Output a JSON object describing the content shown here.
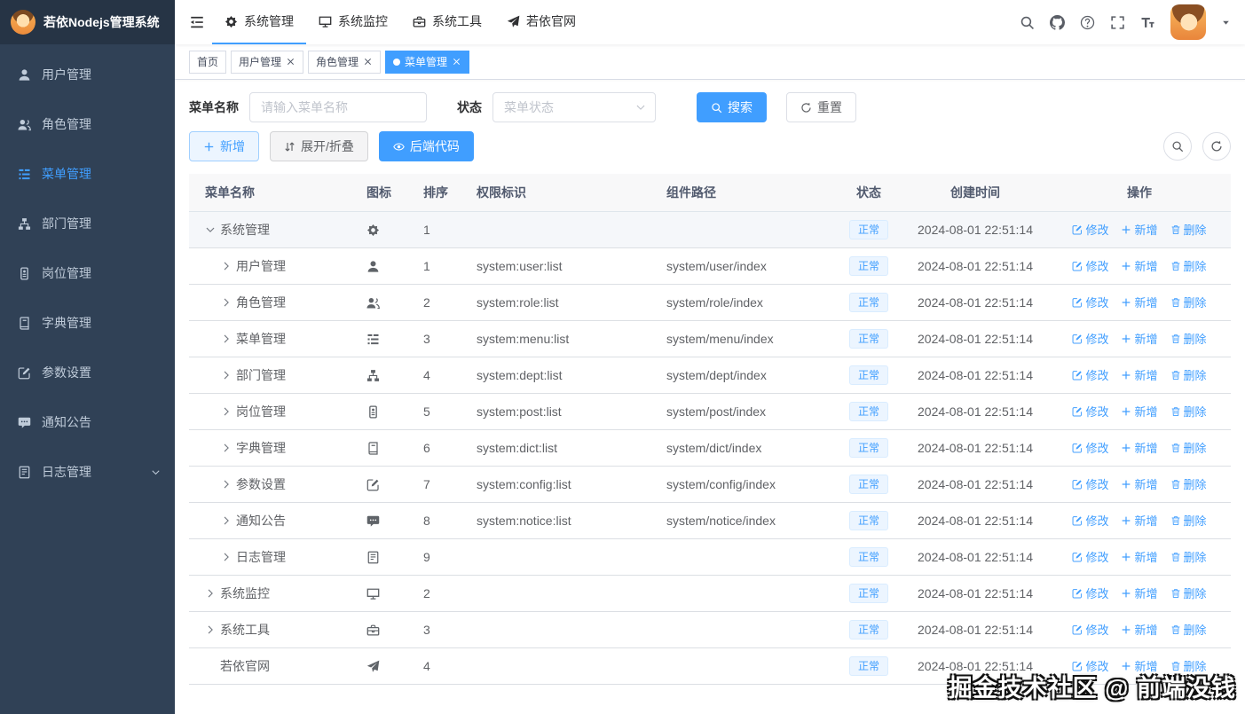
{
  "app": {
    "title": "若依Nodejs管理系统"
  },
  "colors": {
    "primary": "#409eff",
    "sidebar_bg": "#304156",
    "tag_active_bg": "#409eff",
    "status_tag_bg": "#ecf5ff"
  },
  "navbar": {
    "menus": [
      {
        "label": "系统管理",
        "icon": "gear",
        "active": true
      },
      {
        "label": "系统监控",
        "icon": "monitor",
        "active": false
      },
      {
        "label": "系统工具",
        "icon": "tool",
        "active": false
      },
      {
        "label": "若依官网",
        "icon": "guide",
        "active": false
      }
    ]
  },
  "sidebar": {
    "items": [
      {
        "label": "用户管理",
        "icon": "user",
        "active": false,
        "has_children": false
      },
      {
        "label": "角色管理",
        "icon": "peoples",
        "active": false,
        "has_children": false
      },
      {
        "label": "菜单管理",
        "icon": "tree-table",
        "active": true,
        "has_children": false
      },
      {
        "label": "部门管理",
        "icon": "tree",
        "active": false,
        "has_children": false
      },
      {
        "label": "岗位管理",
        "icon": "post",
        "active": false,
        "has_children": false
      },
      {
        "label": "字典管理",
        "icon": "dict",
        "active": false,
        "has_children": false
      },
      {
        "label": "参数设置",
        "icon": "edit",
        "active": false,
        "has_children": false
      },
      {
        "label": "通知公告",
        "icon": "message",
        "active": false,
        "has_children": false
      },
      {
        "label": "日志管理",
        "icon": "log",
        "active": false,
        "has_children": true
      }
    ]
  },
  "tabs": [
    {
      "label": "首页",
      "closable": false,
      "active": false
    },
    {
      "label": "用户管理",
      "closable": true,
      "active": false
    },
    {
      "label": "角色管理",
      "closable": true,
      "active": false
    },
    {
      "label": "菜单管理",
      "closable": true,
      "active": true
    }
  ],
  "filters": {
    "name_label": "菜单名称",
    "name_placeholder": "请输入菜单名称",
    "status_label": "状态",
    "status_placeholder": "菜单状态",
    "search_button": "搜索",
    "reset_button": "重置"
  },
  "toolbar": {
    "add": "新增",
    "toggle_expand": "展开/折叠",
    "backend_code": "后端代码"
  },
  "table": {
    "columns": [
      "菜单名称",
      "图标",
      "排序",
      "权限标识",
      "组件路径",
      "状态",
      "创建时间",
      "操作"
    ],
    "actions": {
      "edit": "修改",
      "add": "新增",
      "delete": "删除"
    },
    "rows": [
      {
        "name": "系统管理",
        "icon": "gear",
        "indent": 0,
        "expand": "down",
        "order": 1,
        "perms": "",
        "component": "",
        "status": "正常",
        "created": "2024-08-01 22:51:14"
      },
      {
        "name": "用户管理",
        "icon": "user",
        "indent": 1,
        "expand": "right",
        "order": 1,
        "perms": "system:user:list",
        "component": "system/user/index",
        "status": "正常",
        "created": "2024-08-01 22:51:14"
      },
      {
        "name": "角色管理",
        "icon": "peoples",
        "indent": 1,
        "expand": "right",
        "order": 2,
        "perms": "system:role:list",
        "component": "system/role/index",
        "status": "正常",
        "created": "2024-08-01 22:51:14"
      },
      {
        "name": "菜单管理",
        "icon": "tree-table",
        "indent": 1,
        "expand": "right",
        "order": 3,
        "perms": "system:menu:list",
        "component": "system/menu/index",
        "status": "正常",
        "created": "2024-08-01 22:51:14"
      },
      {
        "name": "部门管理",
        "icon": "tree",
        "indent": 1,
        "expand": "right",
        "order": 4,
        "perms": "system:dept:list",
        "component": "system/dept/index",
        "status": "正常",
        "created": "2024-08-01 22:51:14"
      },
      {
        "name": "岗位管理",
        "icon": "post",
        "indent": 1,
        "expand": "right",
        "order": 5,
        "perms": "system:post:list",
        "component": "system/post/index",
        "status": "正常",
        "created": "2024-08-01 22:51:14"
      },
      {
        "name": "字典管理",
        "icon": "dict",
        "indent": 1,
        "expand": "right",
        "order": 6,
        "perms": "system:dict:list",
        "component": "system/dict/index",
        "status": "正常",
        "created": "2024-08-01 22:51:14"
      },
      {
        "name": "参数设置",
        "icon": "edit",
        "indent": 1,
        "expand": "right",
        "order": 7,
        "perms": "system:config:list",
        "component": "system/config/index",
        "status": "正常",
        "created": "2024-08-01 22:51:14"
      },
      {
        "name": "通知公告",
        "icon": "message",
        "indent": 1,
        "expand": "right",
        "order": 8,
        "perms": "system:notice:list",
        "component": "system/notice/index",
        "status": "正常",
        "created": "2024-08-01 22:51:14"
      },
      {
        "name": "日志管理",
        "icon": "log",
        "indent": 1,
        "expand": "right",
        "order": 9,
        "perms": "",
        "component": "",
        "status": "正常",
        "created": "2024-08-01 22:51:14"
      },
      {
        "name": "系统监控",
        "icon": "monitor",
        "indent": 0,
        "expand": "right",
        "order": 2,
        "perms": "",
        "component": "",
        "status": "正常",
        "created": "2024-08-01 22:51:14"
      },
      {
        "name": "系统工具",
        "icon": "tool",
        "indent": 0,
        "expand": "right",
        "order": 3,
        "perms": "",
        "component": "",
        "status": "正常",
        "created": "2024-08-01 22:51:14"
      },
      {
        "name": "若依官网",
        "icon": "guide",
        "indent": 0,
        "expand": "none",
        "order": 4,
        "perms": "",
        "component": "",
        "status": "正常",
        "created": "2024-08-01 22:51:14"
      }
    ]
  },
  "watermark": "掘金技术社区 @ 前端没钱"
}
